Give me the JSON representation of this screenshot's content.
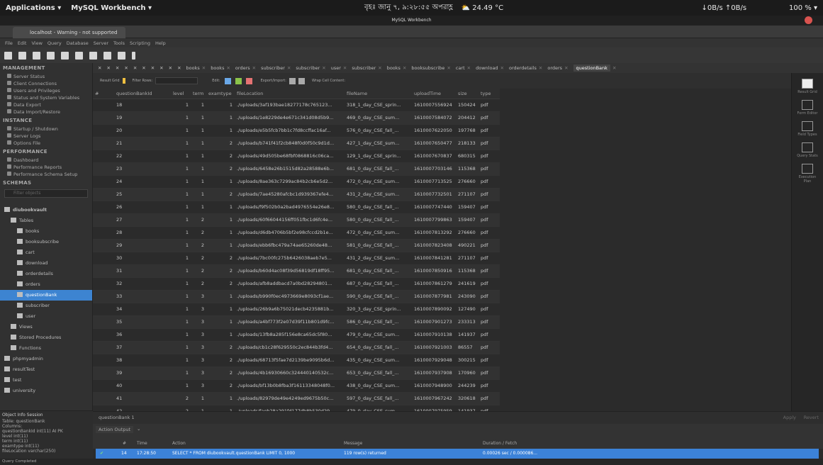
{
  "system_bar": {
    "applications": "Applications ▾",
    "app_name": "MySQL Workbench ▾",
    "clock": "বৃহঃ জানু ৭, ৯:২৮:৫৫ অপরাহ্ণ",
    "weather": "⛅ 24.49 °C",
    "net": "↓0B/s ↑0B/s",
    "battery": "100 % ▾"
  },
  "window_title": "MySQL Workbench",
  "connection_tab": "localhost - Warning - not supported",
  "menu": [
    "File",
    "Edit",
    "View",
    "Query",
    "Database",
    "Server",
    "Tools",
    "Scripting",
    "Help"
  ],
  "sidebar": {
    "management_title": "MANAGEMENT",
    "management": [
      "Server Status",
      "Client Connections",
      "Users and Privileges",
      "Status and System Variables",
      "Data Export",
      "Data Import/Restore"
    ],
    "instance_title": "INSTANCE",
    "instance": [
      "Startup / Shutdown",
      "Server Logs",
      "Options File"
    ],
    "performance_title": "PERFORMANCE",
    "performance": [
      "Dashboard",
      "Performance Reports",
      "Performance Schema Setup"
    ],
    "schemas_title": "SCHEMAS",
    "filter_placeholder": "Filter objects",
    "tree": [
      {
        "label": "diubookvault",
        "level": 0,
        "bold": true
      },
      {
        "label": "Tables",
        "level": 1
      },
      {
        "label": "books",
        "level": 2
      },
      {
        "label": "booksubscribe",
        "level": 2
      },
      {
        "label": "cart",
        "level": 2
      },
      {
        "label": "download",
        "level": 2
      },
      {
        "label": "orderdetails",
        "level": 2
      },
      {
        "label": "orders",
        "level": 2
      },
      {
        "label": "questionBank",
        "level": 2,
        "selected": true
      },
      {
        "label": "subscriber",
        "level": 2
      },
      {
        "label": "user",
        "level": 2
      },
      {
        "label": "Views",
        "level": 1
      },
      {
        "label": "Stored Procedures",
        "level": 1
      },
      {
        "label": "Functions",
        "level": 1
      },
      {
        "label": "phpmyadmin",
        "level": 0
      },
      {
        "label": "resultTest",
        "level": 0
      },
      {
        "label": "test",
        "level": 0
      },
      {
        "label": "university",
        "level": 0
      }
    ]
  },
  "object_info": {
    "tabs": "Object Info   Session",
    "lines": [
      "Table: questionBank",
      "Columns:",
      "questionBankId   int(11) AI PK",
      "level   int(11)",
      "term   int(11)",
      "examtype   int(11)",
      "fileLocation   varchar(250)"
    ]
  },
  "query_tabs": [
    "books",
    "books",
    "orders",
    "subscriber",
    "subscriber",
    "user",
    "subscriber",
    "books",
    "booksubscribe",
    "cart",
    "download",
    "orderdetails",
    "orders",
    "questionBank"
  ],
  "grid_toolbar": {
    "result_grid": "Result Grid",
    "filter_rows": "Filter Rows:",
    "edit": "Edit:",
    "export": "Export/Import:",
    "wrap": "Wrap Cell Content:"
  },
  "columns": [
    "#",
    "questionBankId",
    "level",
    "term",
    "examtype",
    "fileLocation",
    "fileName",
    "uploadTime",
    "size",
    "type"
  ],
  "rows": [
    [
      "",
      "18",
      "1",
      "1",
      "1",
      "./uploads/3af193bae18277178c765123...",
      "318_1_day_CSE_sprin...",
      "1610007556924",
      "150424",
      "pdf"
    ],
    [
      "",
      "19",
      "1",
      "1",
      "1",
      "./uploads/1e8229de4e671c341d08d5b9...",
      "469_0_day_CSE_sum...",
      "1610007584072",
      "204412",
      "pdf"
    ],
    [
      "",
      "20",
      "1",
      "1",
      "1",
      "./uploads/e5b5fcb7bb1c7fd8ccffac16af...",
      "576_0_day_CSE_fall_...",
      "1610007622050",
      "197768",
      "pdf"
    ],
    [
      "",
      "21",
      "1",
      "1",
      "2",
      "./uploads/b741f41f2cb848f0d0f50c9d1d...",
      "427_1_day_CSE_sum...",
      "1610007650477",
      "218133",
      "pdf"
    ],
    [
      "",
      "22",
      "1",
      "1",
      "2",
      "./uploads/49d505be68fbf0868816c06ca...",
      "129_1_day_CSE_sprin...",
      "1610007670837",
      "680315",
      "pdf"
    ],
    [
      "",
      "23",
      "1",
      "1",
      "2",
      "./uploads/6458e26b1515d82a28588e6b...",
      "681_0_day_CSE_fall_...",
      "1610007703146",
      "115368",
      "pdf"
    ],
    [
      "",
      "24",
      "1",
      "1",
      "1",
      "./uploads/8ae363c7299ac84b2cb6e5d2...",
      "472_0_day_CSE_sum...",
      "1610007713525",
      "276660",
      "pdf"
    ],
    [
      "",
      "25",
      "1",
      "1",
      "2",
      "./uploads/7ae45280afcbc1d939367efe4...",
      "431_2_day_CSE_sum...",
      "1610007732501",
      "271107",
      "pdf"
    ],
    [
      "",
      "26",
      "1",
      "1",
      "1",
      "./uploads/f9f502b0a2bad4976554e26e8...",
      "580_0_day_CSE_fall_...",
      "1610007747440",
      "159407",
      "pdf"
    ],
    [
      "",
      "27",
      "1",
      "2",
      "1",
      "./uploads/60f66044156ff051fbc1d6fc4e...",
      "580_0_day_CSE_fall_...",
      "1610007799863",
      "159407",
      "pdf"
    ],
    [
      "",
      "28",
      "1",
      "2",
      "1",
      "./uploads/d6db4706b5bf2e98cfccd2b1e...",
      "472_0_day_CSE_sum...",
      "1610007813292",
      "276660",
      "pdf"
    ],
    [
      "",
      "29",
      "1",
      "2",
      "1",
      "./uploads/ebb6fbc479a74ae65260de48...",
      "581_0_day_CSE_fall_...",
      "1610007823408",
      "490221",
      "pdf"
    ],
    [
      "",
      "30",
      "1",
      "2",
      "2",
      "./uploads/7bc00fc275b6426038aeb7e5...",
      "431_2_day_CSE_sum...",
      "1610007841281",
      "271107",
      "pdf"
    ],
    [
      "",
      "31",
      "1",
      "2",
      "2",
      "./uploads/b60d4ac08f39d56819df18ff95...",
      "681_0_day_CSE_fall_...",
      "1610007850916",
      "115368",
      "pdf"
    ],
    [
      "",
      "32",
      "1",
      "2",
      "2",
      "./uploads/afb8addbacd7a0bd28294801...",
      "687_0_day_CSE_fall_...",
      "1610007861279",
      "241619",
      "pdf"
    ],
    [
      "",
      "33",
      "1",
      "3",
      "1",
      "./uploads/b990f0ec4973669e8093cf1ae...",
      "590_0_day_CSE_fall_...",
      "1610007877981",
      "243090",
      "pdf"
    ],
    [
      "",
      "34",
      "1",
      "3",
      "1",
      "./uploads/26b9a6b75021decb4235881b...",
      "320_3_day_CSE_sprin...",
      "1610007890092",
      "127490",
      "pdf"
    ],
    [
      "",
      "35",
      "1",
      "3",
      "1",
      "./uploads/a4bf773f2e07d39f11b801d9fc...",
      "586_0_day_CSE_fall_...",
      "1610007901273",
      "233313",
      "pdf"
    ],
    [
      "",
      "36",
      "1",
      "3",
      "1",
      "./uploads/13fb8a285f156e8ca65dc5f80...",
      "479_0_day_CSE_sum...",
      "1610007910138",
      "141937",
      "pdf"
    ],
    [
      "",
      "37",
      "1",
      "3",
      "2",
      "./uploads/cb1c28f629550c2ec844b3fd4...",
      "654_0_day_CSE_fall_...",
      "1610007921003",
      "86557",
      "pdf"
    ],
    [
      "",
      "38",
      "1",
      "3",
      "2",
      "./uploads/68713f5fae7d2139be9095b6d...",
      "435_0_day_CSE_sum...",
      "1610007929048",
      "300215",
      "pdf"
    ],
    [
      "",
      "39",
      "1",
      "3",
      "2",
      "./uploads/4b16930660c324440140532c...",
      "653_0_day_CSE_fall_...",
      "1610007937908",
      "170960",
      "pdf"
    ],
    [
      "",
      "40",
      "1",
      "3",
      "2",
      "./uploads/bf13b0b8fba3f16113348048f0...",
      "438_0_day_CSE_sum...",
      "1610007948900",
      "244239",
      "pdf"
    ],
    [
      "",
      "41",
      "2",
      "1",
      "1",
      "./uploads/82979de49e4249ed9675b50c...",
      "597_0_day_CSE_fall_...",
      "1610007967242",
      "320618",
      "pdf"
    ],
    [
      "",
      "42",
      "2",
      "1",
      "1",
      "./uploads/faeb28a291fd177db8b530d29...",
      "479_0_day_CSE_sum...",
      "1610007975959",
      "141937",
      "pdf"
    ]
  ],
  "right_panel": [
    "Result Grid",
    "Form Editor",
    "Field Types",
    "Query Stats",
    "Execution Plan"
  ],
  "result_tab": "questionBank 1",
  "apply": "Apply",
  "revert": "Revert",
  "output": {
    "selector": "Action Output",
    "headers": [
      "#",
      "Time",
      "Action",
      "Message",
      "Duration / Fetch"
    ],
    "row": [
      "14",
      "17:28:50",
      "SELECT * FROM diubookvault.questionBank LIMIT 0, 1000",
      "119 row(s) returned",
      "0.00026 sec / 0.000086..."
    ]
  },
  "status": "Query Completed"
}
